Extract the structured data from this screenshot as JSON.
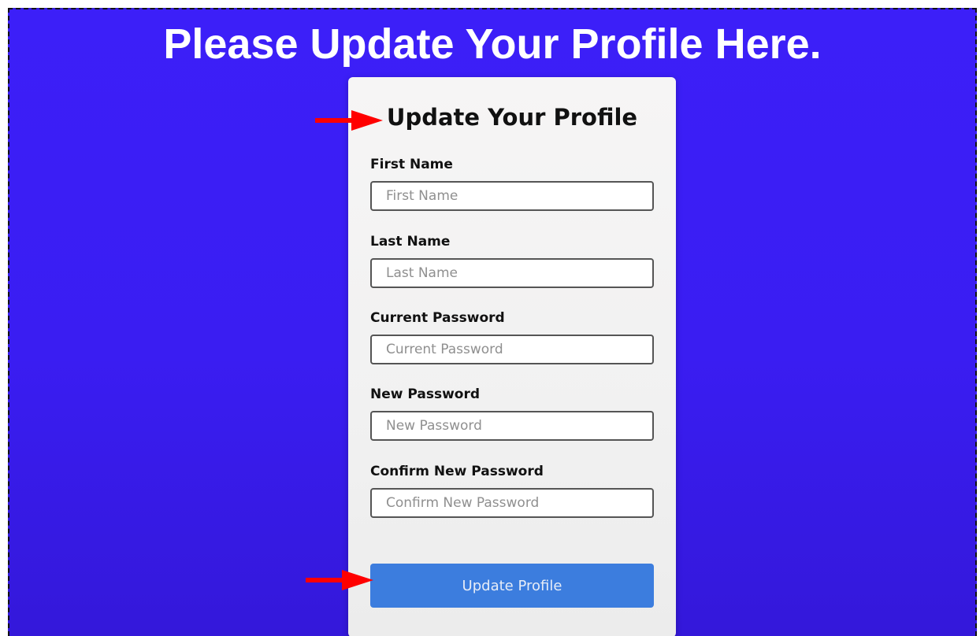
{
  "page": {
    "title": "Please Update Your Profile Here."
  },
  "form": {
    "title": "Update Your Profile",
    "fields": [
      {
        "label": "First Name",
        "placeholder": "First Name"
      },
      {
        "label": "Last Name",
        "placeholder": "Last Name"
      },
      {
        "label": "Current Password",
        "placeholder": "Current Password"
      },
      {
        "label": "New Password",
        "placeholder": "New Password"
      },
      {
        "label": "Confirm New Password",
        "placeholder": "Confirm New Password"
      }
    ],
    "submit_label": "Update Profile"
  },
  "colors": {
    "background": "#3c1ff8",
    "card": "#f3f3f3",
    "button": "#3c7dde",
    "annotation_arrow": "#ff0000"
  },
  "annotations": {
    "arrows": [
      "red-arrow-icon",
      "red-arrow-icon"
    ]
  }
}
